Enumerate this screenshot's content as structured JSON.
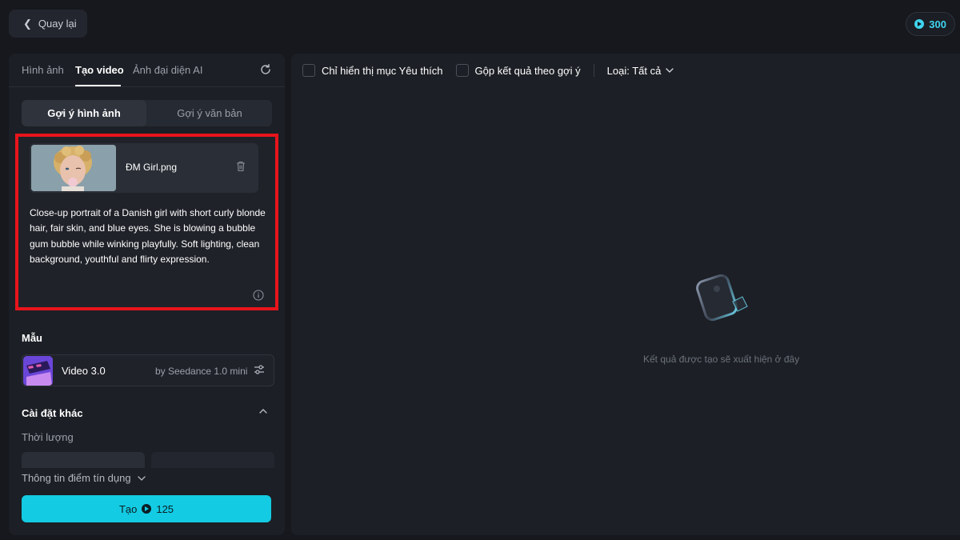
{
  "topbar": {
    "back_label": "Quay lại",
    "credits": "300"
  },
  "tabs": [
    {
      "label": "Hình ảnh",
      "active": false
    },
    {
      "label": "Tạo video",
      "active": true
    },
    {
      "label": "Ảnh đại diện AI",
      "active": false
    }
  ],
  "segments": [
    {
      "label": "Gợi ý hình ảnh",
      "active": true
    },
    {
      "label": "Gợi ý văn bản",
      "active": false
    }
  ],
  "upload": {
    "file_name": "ĐM Girl.png"
  },
  "prompt": {
    "text": "Close-up portrait of a Danish girl with short curly blonde hair, fair skin, and blue eyes. She is blowing a bubble gum bubble while winking playfully. Soft lighting, clean background, youthful and flirty expression."
  },
  "model_section": {
    "title": "Mẫu",
    "model_name": "Video 3.0",
    "model_by": "by Seedance 1.0 mini"
  },
  "other_settings": {
    "title": "Cài đặt khác",
    "duration_label": "Thời lượng"
  },
  "footer": {
    "credit_info_label": "Thông tin điểm tín dụng",
    "create_label": "Tạo",
    "create_cost": "125"
  },
  "filters": {
    "favorites_label": "Chỉ hiển thị mục Yêu thích",
    "group_label": "Gộp kết quả theo gợi ý",
    "type_label": "Loại: Tất cả"
  },
  "empty_state": {
    "message": "Kết quả được tạo sẽ xuất hiện ở đây"
  },
  "colors": {
    "accent": "#13cbe3",
    "highlight_border": "#e8141b",
    "credits_text": "#3fd4f0"
  },
  "icons": [
    "chevron-left-icon",
    "coin-icon",
    "refresh-icon",
    "trash-icon",
    "info-icon",
    "sliders-icon",
    "chevron-up-icon",
    "chevron-down-icon",
    "image-placeholder-icon"
  ]
}
